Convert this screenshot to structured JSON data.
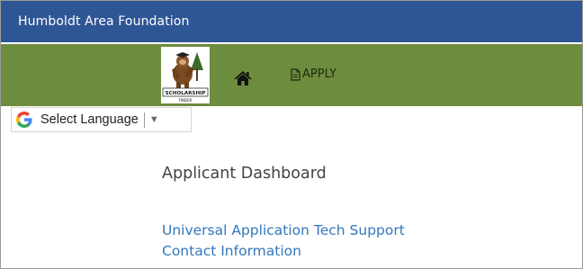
{
  "header": {
    "title": "Humboldt Area Foundation",
    "bg_color": "#2f5694"
  },
  "nav": {
    "bg_color": "#6e8c3e",
    "logo_text": "SCHOLARSHIP FINDER",
    "home_icon": "home-icon",
    "apply_label": "APPLY",
    "apply_icon": "document-icon"
  },
  "language": {
    "label": "Select Language",
    "icon": "google-g-icon",
    "caret": "▼"
  },
  "main": {
    "page_title": "Applicant Dashboard",
    "links": [
      "Universal Application Tech Support",
      "Contact Information"
    ],
    "link_color": "#3477bd"
  }
}
